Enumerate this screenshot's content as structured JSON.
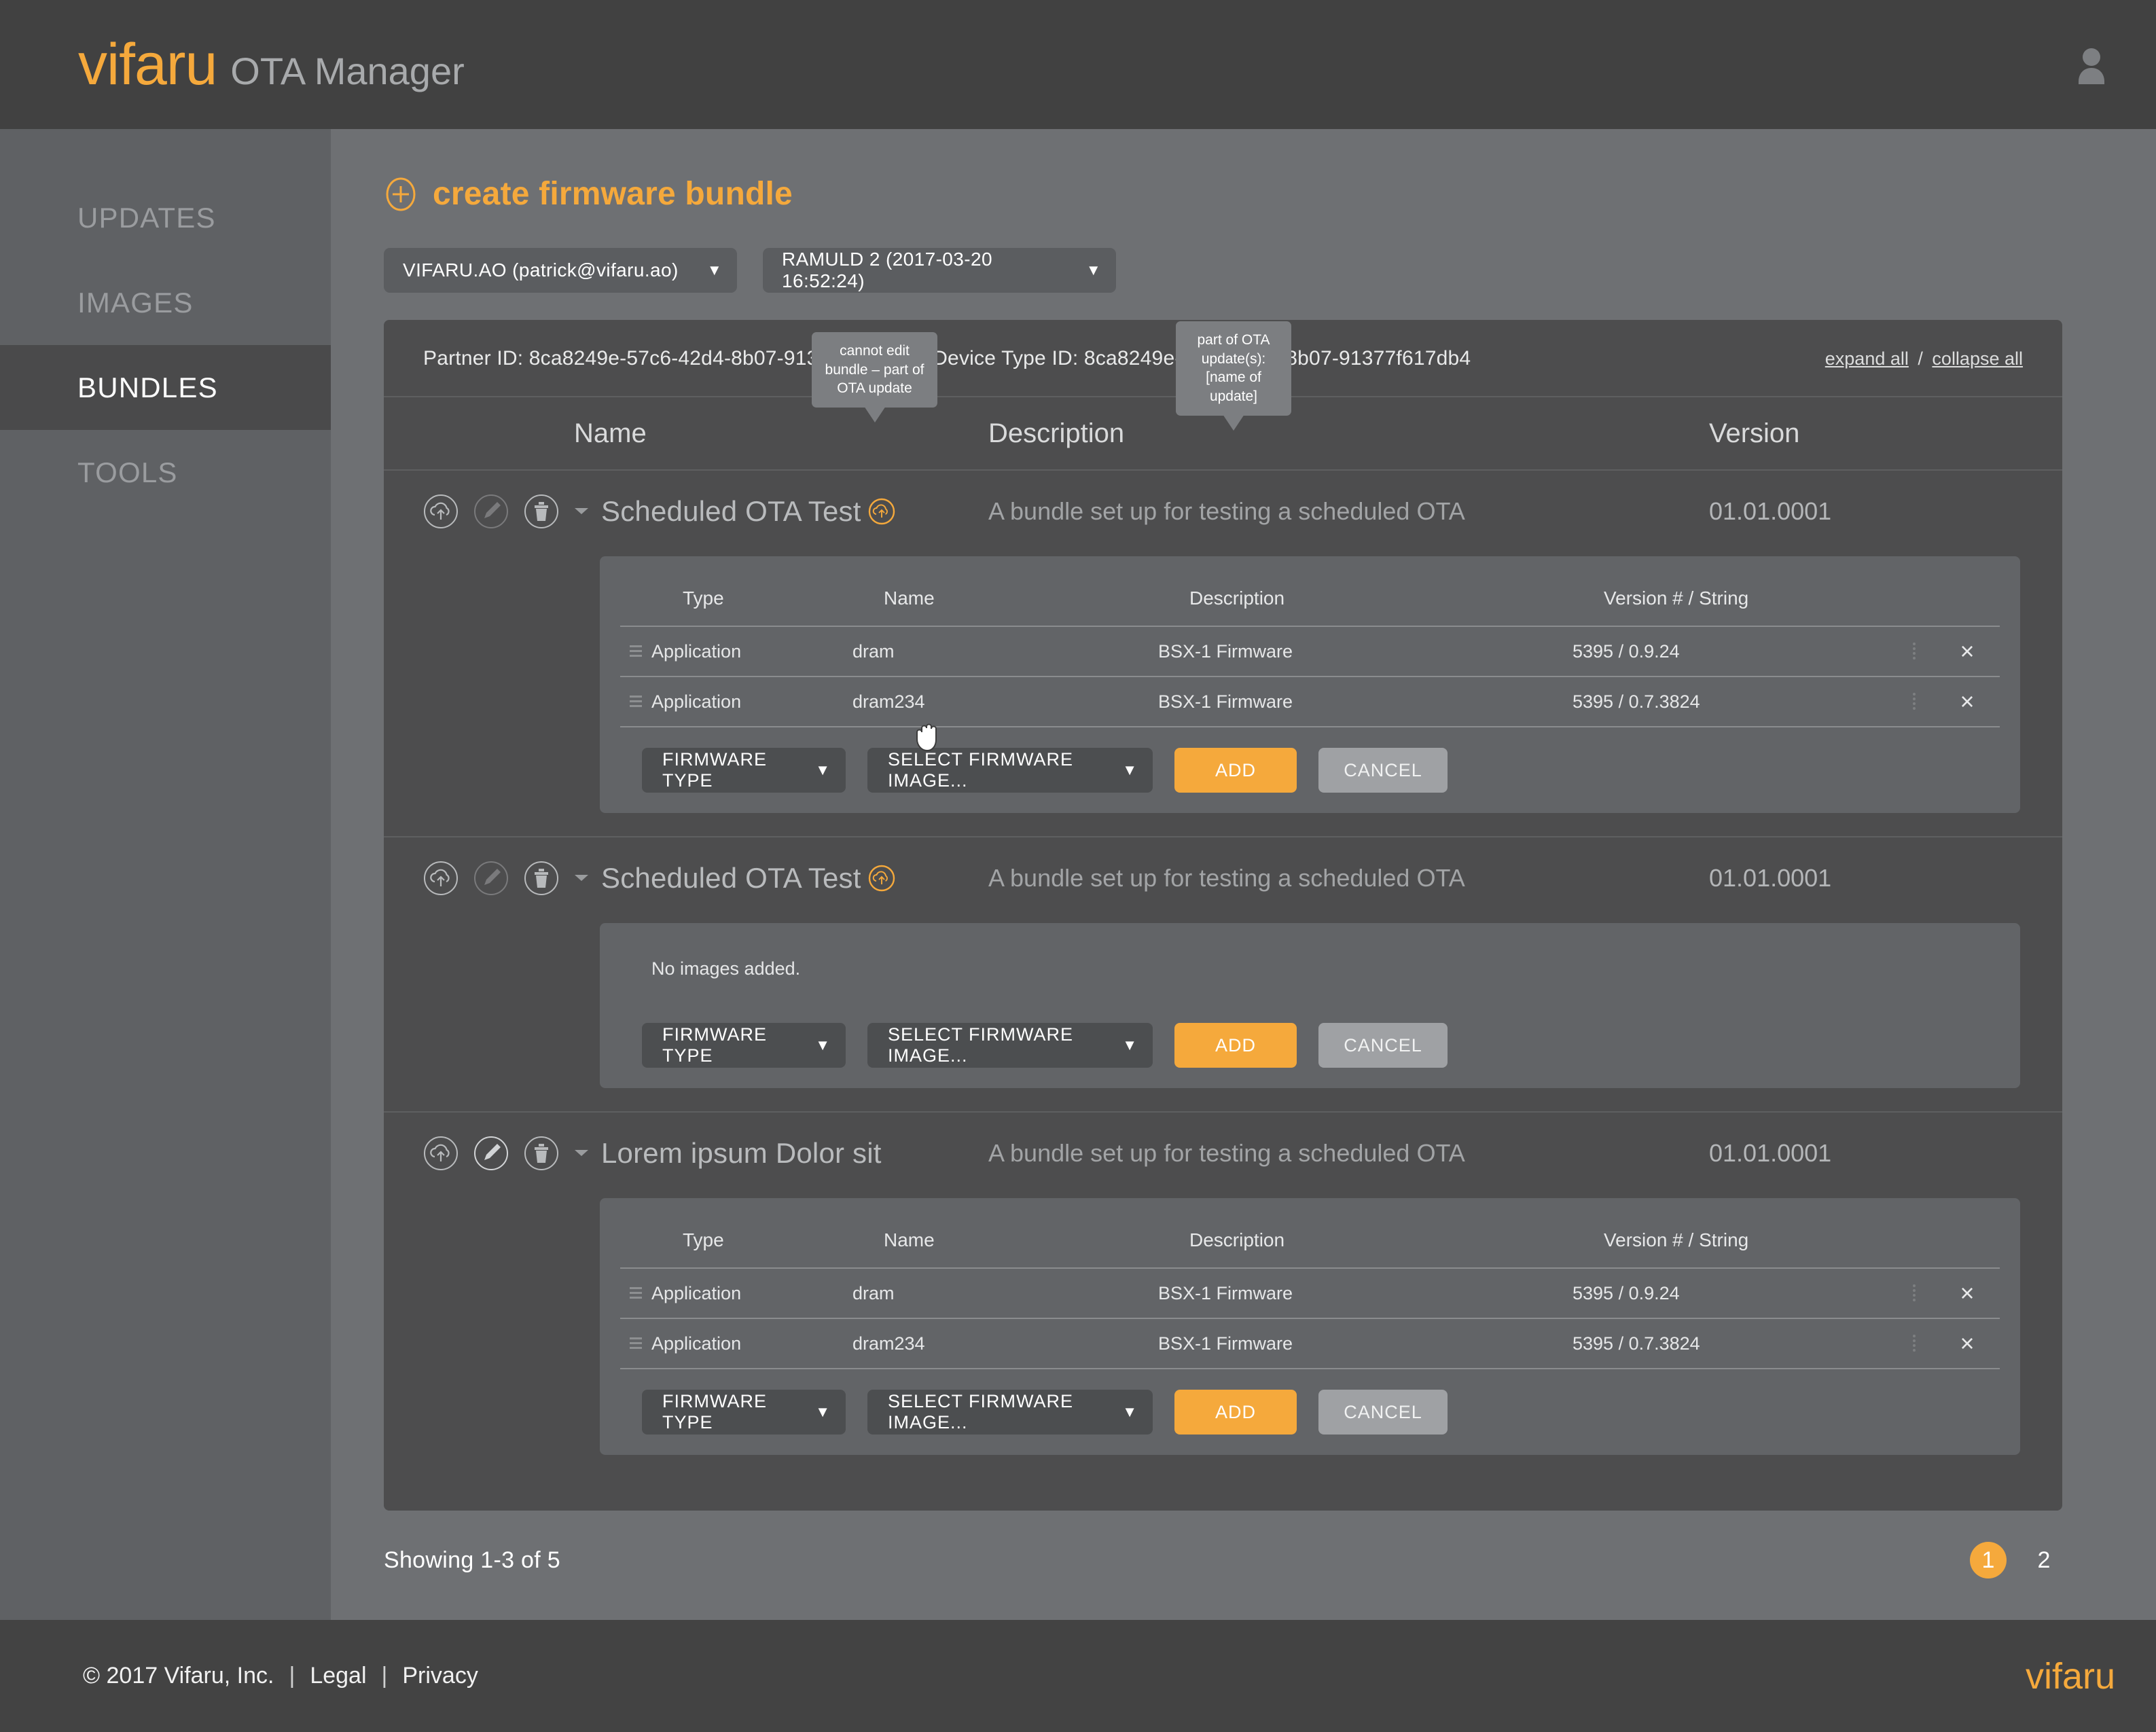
{
  "header": {
    "brand_mark": "vifaru",
    "brand_sub": "OTA Manager",
    "avatar_icon": "user-avatar-icon"
  },
  "sidebar": {
    "items": [
      {
        "label": "UPDATES",
        "active": false
      },
      {
        "label": "IMAGES",
        "active": false
      },
      {
        "label": "BUNDLES",
        "active": true
      },
      {
        "label": "TOOLS",
        "active": false
      }
    ]
  },
  "main": {
    "create_label": "create firmware bundle",
    "plus_icon": "plus-circle-icon",
    "selectors": [
      {
        "name": "partner-select",
        "value": "VIFARU.AO (patrick@vifaru.ao)"
      },
      {
        "name": "device-type-select",
        "value": "RAMULD 2 (2017-03-20 16:52:24)"
      }
    ],
    "ids_line": "Partner ID: 8ca8249e-57c6-42d4-8b07-91377f617db4  |  Device Type ID: 8ca8249e-57c6-42d4-8b07-91377f617db4",
    "expand_all": "expand all",
    "separator": "/",
    "collapse_all": "collapse all",
    "columns": {
      "name": "Name",
      "description": "Description",
      "version": "Version"
    },
    "tooltips": {
      "edit_disabled": "cannot edit bundle – part of OTA update",
      "ota_badge": "part of OTA update(s): [name of update]"
    },
    "inner_columns": {
      "type": "Type",
      "name": "Name",
      "description": "Description",
      "version": "Version # / String"
    },
    "inner_buttons": {
      "firmware_type": "FIRMWARE TYPE",
      "select_image": "SELECT FIRMWARE IMAGE...",
      "add": "ADD",
      "cancel": "CANCEL"
    },
    "empty_text": "No images added.",
    "remove_icon": "×",
    "bundles": [
      {
        "name": "Scheduled OTA Test",
        "description": "A bundle set up for testing a scheduled OTA",
        "version": "01.01.0001",
        "part_of_ota": true,
        "edit_disabled": true,
        "images": [
          {
            "type": "Application",
            "name": "dram",
            "description": "BSX-1 Firmware",
            "version": "5395 / 0.9.24"
          },
          {
            "type": "Application",
            "name": "dram234",
            "description": "BSX-1 Firmware",
            "version": "5395 / 0.7.3824"
          }
        ]
      },
      {
        "name": "Scheduled OTA Test",
        "description": "A bundle set up for testing a scheduled OTA",
        "version": "01.01.0001",
        "part_of_ota": true,
        "edit_disabled": true,
        "images": []
      },
      {
        "name": "Lorem ipsum Dolor sit",
        "description": "A bundle set up for testing a scheduled OTA",
        "version": "01.01.0001",
        "part_of_ota": false,
        "edit_disabled": false,
        "images": [
          {
            "type": "Application",
            "name": "dram",
            "description": "BSX-1 Firmware",
            "version": "5395 / 0.9.24"
          },
          {
            "type": "Application",
            "name": "dram234",
            "description": "BSX-1 Firmware",
            "version": "5395 / 0.7.3824"
          }
        ]
      }
    ],
    "showing": "Showing 1-3 of 5",
    "pages": [
      {
        "label": "1",
        "active": true
      },
      {
        "label": "2",
        "active": false
      }
    ]
  },
  "footer": {
    "copyright": "© 2017 Vifaru, Inc.",
    "sep1": "|",
    "legal": "Legal",
    "sep2": "|",
    "privacy": "Privacy",
    "logo": "vifaru"
  },
  "colors": {
    "accent": "#f5a93c",
    "header_bg": "#414141",
    "sidebar_bg": "#5f6164",
    "sidebar_active_bg": "#4a4a4b",
    "main_bg": "#6e7073",
    "panel_bg": "#4d4d4e",
    "inner_bg": "#626467"
  }
}
